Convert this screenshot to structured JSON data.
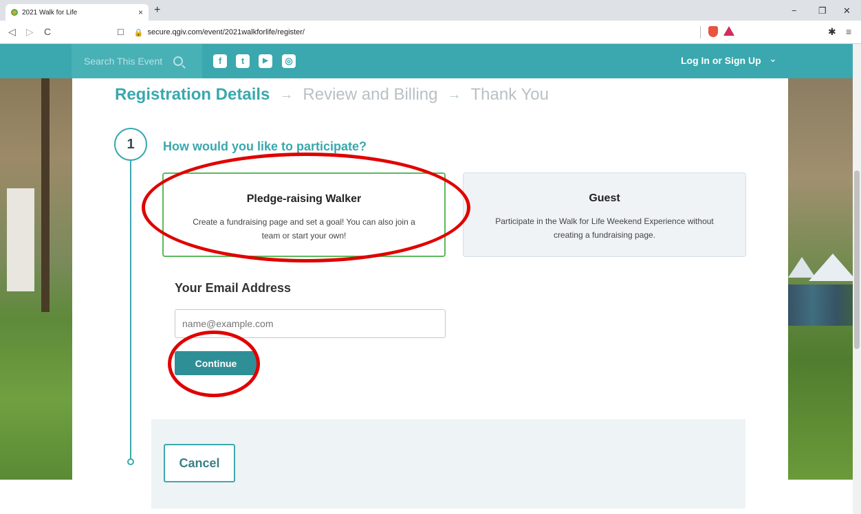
{
  "browser": {
    "tab_title": "2021 Walk for Life",
    "tab_close": "×",
    "new_tab": "+",
    "url": "secure.qgiv.com/event/2021walkforlife/register/",
    "back": "◁",
    "forward": "▷",
    "reload": "C",
    "bookmark": "☐",
    "lock": "🔒",
    "extensions": "✱",
    "menu": "≡",
    "minimize": "−",
    "restore": "❐",
    "close": "✕"
  },
  "site_nav": {
    "search_placeholder": "Search This Event",
    "social": [
      {
        "icon": "facebook-icon",
        "glyph": "f"
      },
      {
        "icon": "twitter-icon",
        "glyph": "t"
      },
      {
        "icon": "youtube-icon",
        "glyph": "▶"
      },
      {
        "icon": "instagram-icon",
        "glyph": "◎"
      }
    ],
    "login_label": "Log In or Sign Up",
    "login_chevron": "⌄"
  },
  "steps": {
    "step1": "Registration Details",
    "step2": "Review and Billing",
    "step3": "Thank You",
    "arrow": "→"
  },
  "form": {
    "step_number": "1",
    "question": "How would you like to participate?",
    "options": [
      {
        "title": "Pledge-raising Walker",
        "description": "Create a fundraising page and set a goal! You can also join a team or start your own!",
        "selected": true
      },
      {
        "title": "Guest",
        "description": "Participate in the Walk for Life Weekend Experience without creating a fundraising page.",
        "selected": false
      }
    ],
    "email_label": "Your Email Address",
    "email_placeholder": "name@example.com",
    "continue_label": "Continue",
    "cancel_label": "Cancel"
  },
  "colors": {
    "accent": "#3aa8ae",
    "button": "#2f8f97",
    "selected_border": "#5cb85c",
    "annotation": "#e00000"
  }
}
